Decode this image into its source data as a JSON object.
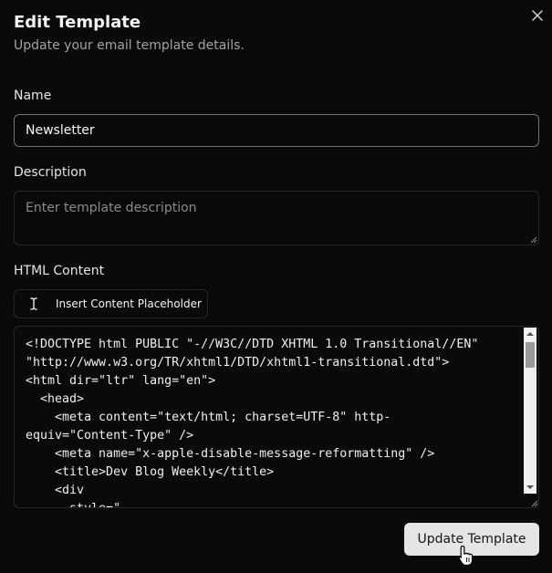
{
  "dialog": {
    "title": "Edit Template",
    "subtitle": "Update your email template details."
  },
  "form": {
    "name_label": "Name",
    "name_value": "Newsletter",
    "description_label": "Description",
    "description_placeholder": "Enter template description",
    "html_label": "HTML Content",
    "insert_placeholder_label": "Insert Content Placeholder",
    "html_content": "<!DOCTYPE html PUBLIC \"-//W3C//DTD XHTML 1.0 Transitional//EN\"\n\"http://www.w3.org/TR/xhtml1/DTD/xhtml1-transitional.dtd\">\n<html dir=\"ltr\" lang=\"en\">\n  <head>\n    <meta content=\"text/html; charset=UTF-8\" http-\nequiv=\"Content-Type\" />\n    <meta name=\"x-apple-disable-message-reformatting\" />\n    <title>Dev Blog Weekly</title>\n    <div\n      style=\"",
    "submit_label": "Update Template"
  },
  "colors": {
    "background": "#0a0a0a",
    "primary_button": "#e5e5e5",
    "border": "#262626",
    "focus_border": "#737373"
  },
  "icons": {
    "close": "close-icon",
    "insert": "text-cursor-icon",
    "pointer": "hand-pointer-icon"
  }
}
